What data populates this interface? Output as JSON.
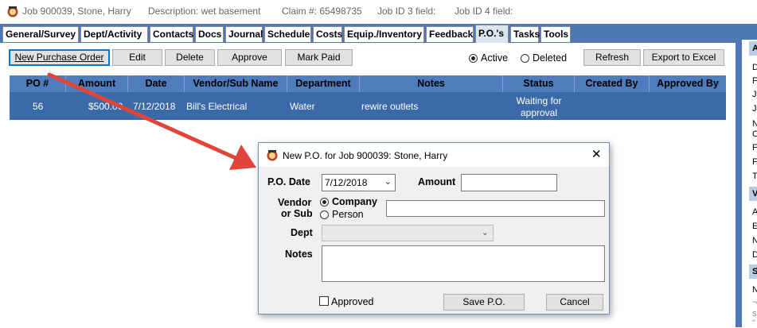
{
  "title_bar": {
    "job": "Job 900039, Stone, Harry",
    "description": "Description: wet basement",
    "claim": "Claim #: 65498735",
    "job_id3": "Job ID 3 field:",
    "job_id4": "Job ID 4 field:"
  },
  "tabs": [
    {
      "label": "General/Survey"
    },
    {
      "label": "Dept/Activity"
    },
    {
      "label": "Contacts"
    },
    {
      "label": "Docs"
    },
    {
      "label": "Journal"
    },
    {
      "label": "Schedule"
    },
    {
      "label": "Costs"
    },
    {
      "label": "Equip./Inventory"
    },
    {
      "label": "Feedback"
    },
    {
      "label": "P.O.'s"
    },
    {
      "label": "Tasks"
    },
    {
      "label": "Tools"
    }
  ],
  "active_tab": "P.O.'s",
  "toolbar": {
    "new_po": "New Purchase Order",
    "edit": "Edit",
    "delete": "Delete",
    "approve": "Approve",
    "mark_paid": "Mark Paid",
    "active_label": "Active",
    "deleted_label": "Deleted",
    "filter_selected": "Active",
    "refresh": "Refresh",
    "export": "Export to Excel"
  },
  "grid": {
    "columns": [
      "PO #",
      "Amount",
      "Date",
      "Vendor/Sub Name",
      "Department",
      "Notes",
      "Status",
      "Created By",
      "Approved By"
    ],
    "rows": [
      {
        "po": "56",
        "amount": "$500.00",
        "date": "7/12/2018",
        "vendor": "Bill's Electrical",
        "department": "Water",
        "notes": "rewire outlets",
        "status_line1": "Waiting for",
        "status_line2": "approval",
        "created_by": "",
        "approved_by": ""
      }
    ]
  },
  "right_panel": {
    "letters": [
      "A",
      "D",
      "F",
      "J",
      "J",
      "N",
      "C",
      "F",
      "F",
      "T",
      "V",
      "A",
      "E",
      "N",
      "D",
      "S",
      "N",
      "¬",
      "s",
      "\""
    ]
  },
  "dialog": {
    "title": "New P.O. for Job 900039: Stone, Harry",
    "po_date_label": "P.O. Date",
    "po_date_value": "7/12/2018",
    "amount_label": "Amount",
    "amount_value": "",
    "vendor_label_1": "Vendor",
    "vendor_label_2": "or Sub",
    "company_label": "Company",
    "person_label": "Person",
    "vendor_type_selected": "Company",
    "vendor_value": "",
    "dept_label": "Dept",
    "dept_value": "",
    "notes_label": "Notes",
    "notes_value": "",
    "approved_label": "Approved",
    "approved_checked": false,
    "save_button": "Save P.O.",
    "cancel_button": "Cancel",
    "close_glyph": "✕"
  },
  "colors": {
    "tab_strip": "#4d78b4",
    "grid_header": "#4e7cbd",
    "grid_row_selected": "#3c6aa8",
    "arrow": "#e0453a"
  }
}
